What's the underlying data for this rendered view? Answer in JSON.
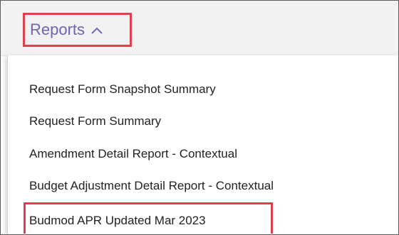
{
  "header": {
    "reports_label": "Reports",
    "icon": "chevron-up-icon"
  },
  "menu": {
    "items": [
      {
        "label": "Request Form Snapshot Summary"
      },
      {
        "label": "Request Form Summary"
      },
      {
        "label": "Amendment Detail Report - Contextual"
      },
      {
        "label": "Budget Adjustment Detail Report - Contextual"
      },
      {
        "label": "Budmod APR Updated Mar 2023"
      }
    ]
  },
  "colors": {
    "accent_label": "#6f63b3",
    "highlight_border": "#e0404b",
    "header_bg": "#f2f2f2",
    "text": "#222222"
  }
}
